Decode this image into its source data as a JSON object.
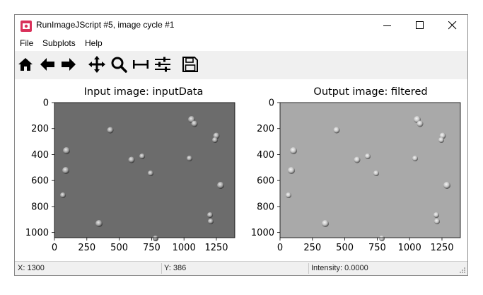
{
  "window": {
    "title": "RunImageJScript #5, image cycle #1"
  },
  "menu": [
    {
      "label": "File"
    },
    {
      "label": "Subplots"
    },
    {
      "label": "Help"
    }
  ],
  "toolbar": {
    "icons": [
      "home-icon",
      "back-arrow-icon",
      "forward-arrow-icon",
      "pan-icon",
      "zoom-icon",
      "subplots-adjust-icon",
      "configure-icon",
      "save-icon"
    ]
  },
  "plots": [
    {
      "title": "Input image: inputData",
      "xticks": [
        "0",
        "250",
        "500",
        "750",
        "1000",
        "1250"
      ],
      "yticks": [
        "0",
        "200",
        "400",
        "600",
        "800",
        "1000"
      ],
      "xlim": [
        0,
        1392
      ],
      "ylim": [
        1040,
        0
      ],
      "background": "#6c6c6c"
    },
    {
      "title": "Output image: filtered",
      "xticks": [
        "0",
        "250",
        "500",
        "750",
        "1000",
        "1250"
      ],
      "yticks": [
        "0",
        "200",
        "400",
        "600",
        "800",
        "1000"
      ],
      "xlim": [
        0,
        1392
      ],
      "ylim": [
        1040,
        0
      ],
      "background": "#a9a9a9"
    }
  ],
  "status": {
    "x": "X: 1300",
    "y": "Y: 386",
    "intensity": "Intensity: 0.0000"
  }
}
